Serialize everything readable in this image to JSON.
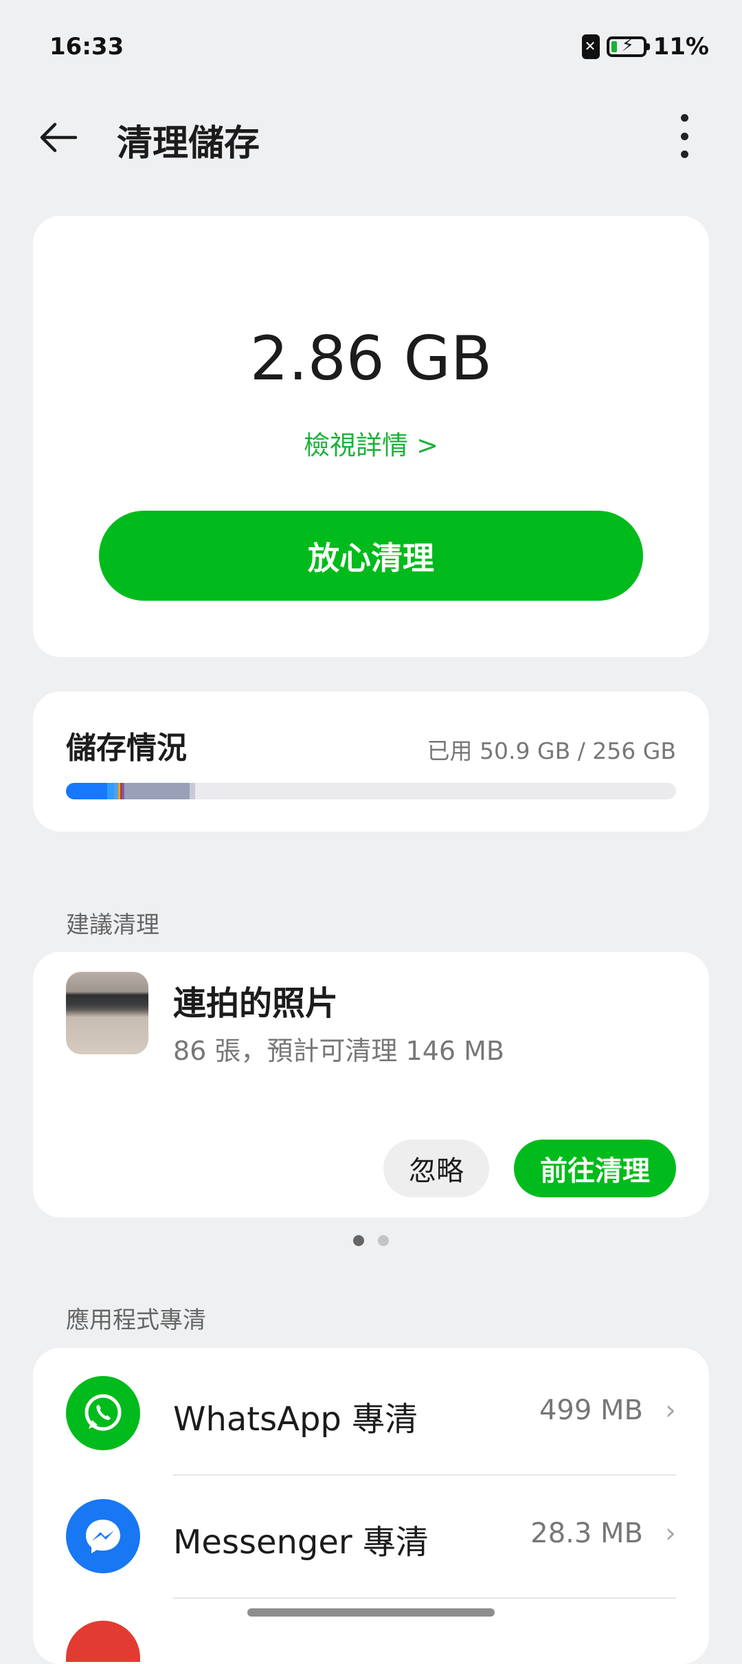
{
  "status_bar": {
    "time": "16:33",
    "battery_percent": "11%",
    "sim_icon": "no-sim-icon",
    "battery_icon": "battery-charging-icon"
  },
  "header": {
    "title": "清理儲存",
    "back_icon": "back-arrow-icon",
    "more_icon": "more-vertical-icon"
  },
  "summary": {
    "size": "2.86 GB",
    "view_details": "檢視詳情 >",
    "clean_button": "放心清理"
  },
  "storage": {
    "title": "儲存情況",
    "usage": "已用 50.9 GB / 256 GB"
  },
  "suggestions": {
    "section_label": "建議清理",
    "item": {
      "title": "連拍的照片",
      "description": "86 張，預計可清理 146 MB"
    },
    "ignore_button": "忽略",
    "go_clean_button": "前往清理",
    "page_count": 2,
    "current_page": 1
  },
  "apps": {
    "section_label": "應用程式專清",
    "items": [
      {
        "name": "WhatsApp 專清",
        "size": "499 MB",
        "icon": "whatsapp-icon",
        "chevron": "›"
      },
      {
        "name": "Messenger 專清",
        "size": "28.3 MB",
        "icon": "messenger-icon",
        "chevron": "›"
      }
    ]
  },
  "colors": {
    "accent": "#00bb1b",
    "link": "#1db23a",
    "background": "#eff0f2"
  }
}
